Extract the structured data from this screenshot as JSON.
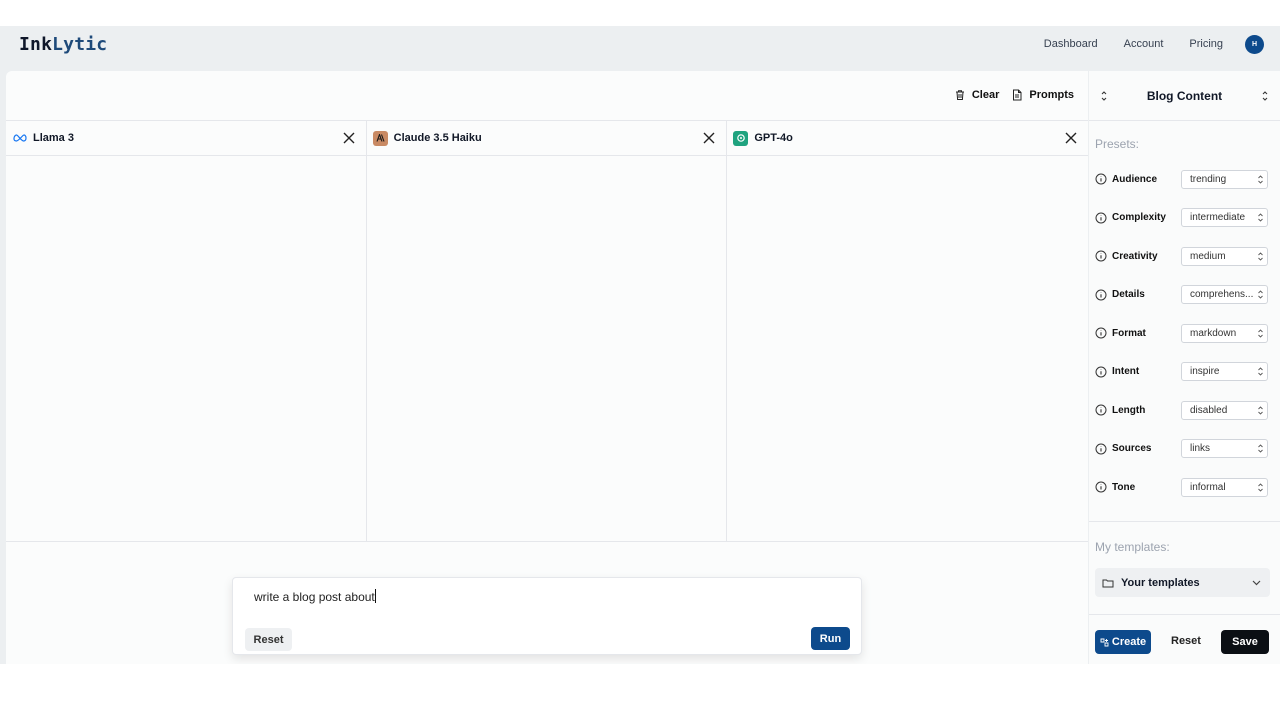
{
  "app": {
    "logo_prefix": "Ink",
    "logo_suffix": "Lytic",
    "nav": [
      "Dashboard",
      "Account",
      "Pricing"
    ],
    "avatar_initial": "H",
    "brand_color": "#0d4a8c"
  },
  "toolbar": {
    "clear_label": "Clear",
    "prompts_label": "Prompts"
  },
  "columns": [
    {
      "model": "Llama 3",
      "icon": "meta-icon"
    },
    {
      "model": "Claude 3.5 Haiku",
      "icon": "anthropic-icon"
    },
    {
      "model": "GPT-4o",
      "icon": "openai-icon"
    }
  ],
  "prompt": {
    "value": "write a blog post about",
    "reset_label": "Reset",
    "run_label": "Run"
  },
  "side": {
    "title": "Blog Content",
    "presets_label": "Presets:",
    "presets": [
      {
        "label": "Audience",
        "value": "trending"
      },
      {
        "label": "Complexity",
        "value": "intermediate"
      },
      {
        "label": "Creativity",
        "value": "medium"
      },
      {
        "label": "Details",
        "value": "comprehens..."
      },
      {
        "label": "Format",
        "value": "markdown"
      },
      {
        "label": "Intent",
        "value": "inspire"
      },
      {
        "label": "Length",
        "value": "disabled"
      },
      {
        "label": "Sources",
        "value": "links"
      },
      {
        "label": "Tone",
        "value": "informal"
      }
    ],
    "templates_label": "My templates:",
    "templates_select": "Your templates",
    "create_label": "Create",
    "reset_label": "Reset",
    "save_label": "Save"
  }
}
